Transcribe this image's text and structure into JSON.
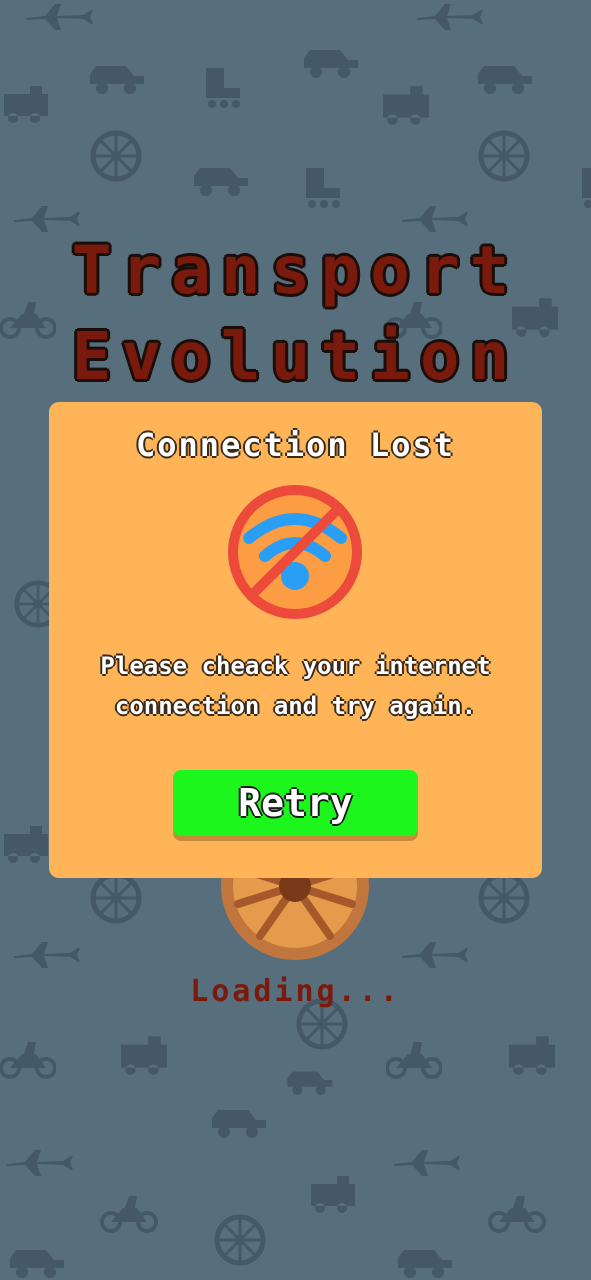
{
  "app": {
    "title_line1": "Transport",
    "title_line2": "Evolution",
    "loading_text": "Loading..."
  },
  "dialog": {
    "title": "Connection Lost",
    "message_line1": "Please cheack your internet",
    "message_line2": "connection and try again.",
    "retry_label": "Retry",
    "icon": "no-wifi-icon"
  },
  "colors": {
    "background": "#576f7c",
    "pattern": "#435766",
    "dialog": "#feb457",
    "retry": "#1df61d",
    "title": "#7a1a0c",
    "prohibition": "#ec4a3a",
    "wifi": "#2a9df4"
  }
}
